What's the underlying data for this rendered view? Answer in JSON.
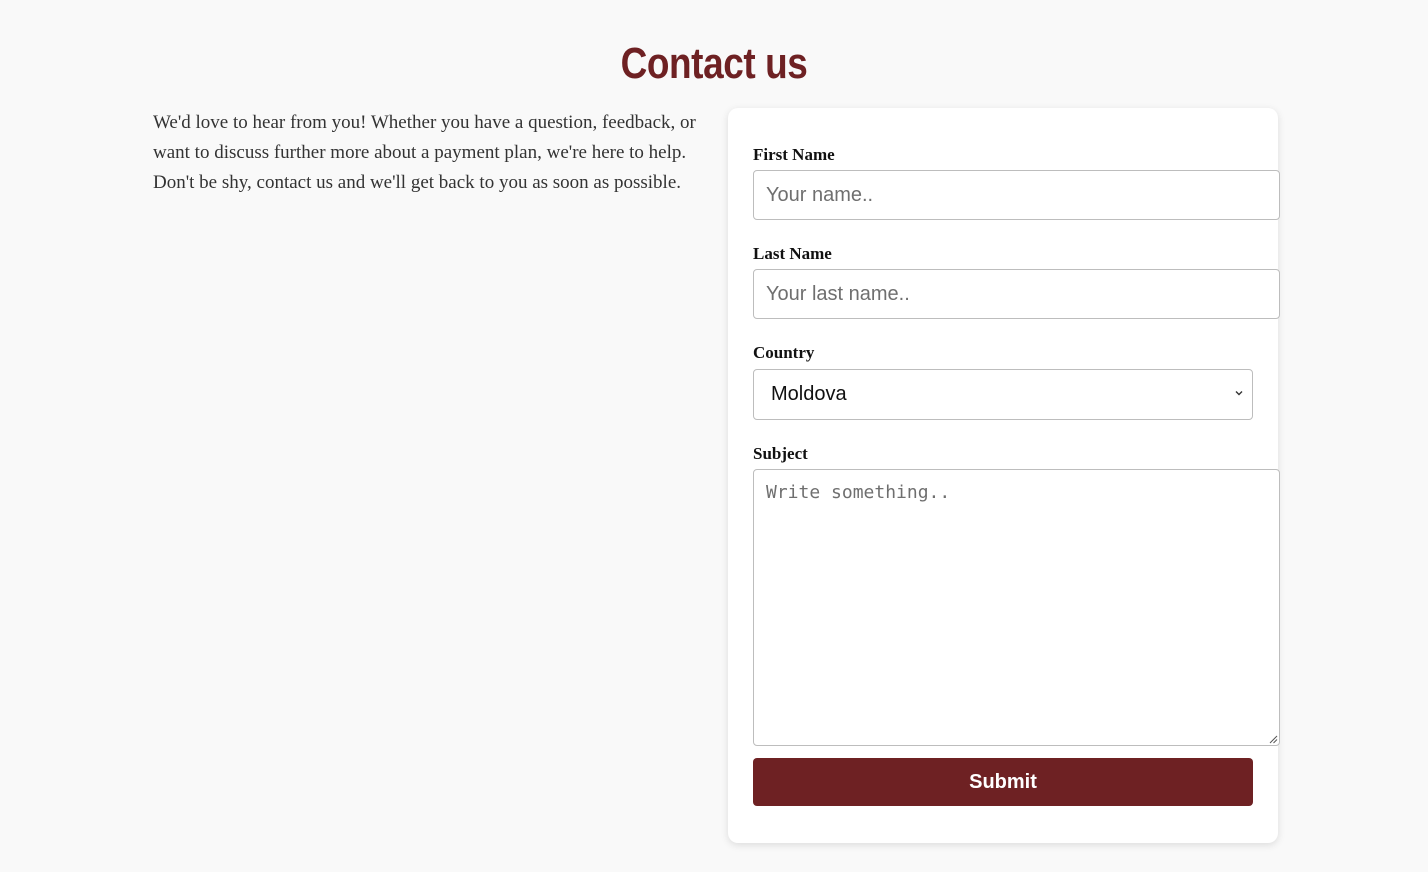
{
  "page": {
    "title": "Contact us",
    "intro": "We'd love to hear from you! Whether you have a question, feedback, or want to discuss further more about a payment plan, we're here to help. Don't be shy, contact us and we'll get back to you as soon as possible."
  },
  "form": {
    "first_name": {
      "label": "First Name",
      "placeholder": "Your name..",
      "value": ""
    },
    "last_name": {
      "label": "Last Name",
      "placeholder": "Your last name..",
      "value": ""
    },
    "country": {
      "label": "Country",
      "selected": "Moldova"
    },
    "subject": {
      "label": "Subject",
      "placeholder": "Write something..",
      "value": ""
    },
    "submit_label": "Submit"
  },
  "colors": {
    "accent": "#6e2123",
    "background": "#f9f9f9",
    "card": "#ffffff"
  },
  "icons": {
    "select_arrow": "chevron-down-icon",
    "textarea_resize": "resize-handle-icon"
  }
}
